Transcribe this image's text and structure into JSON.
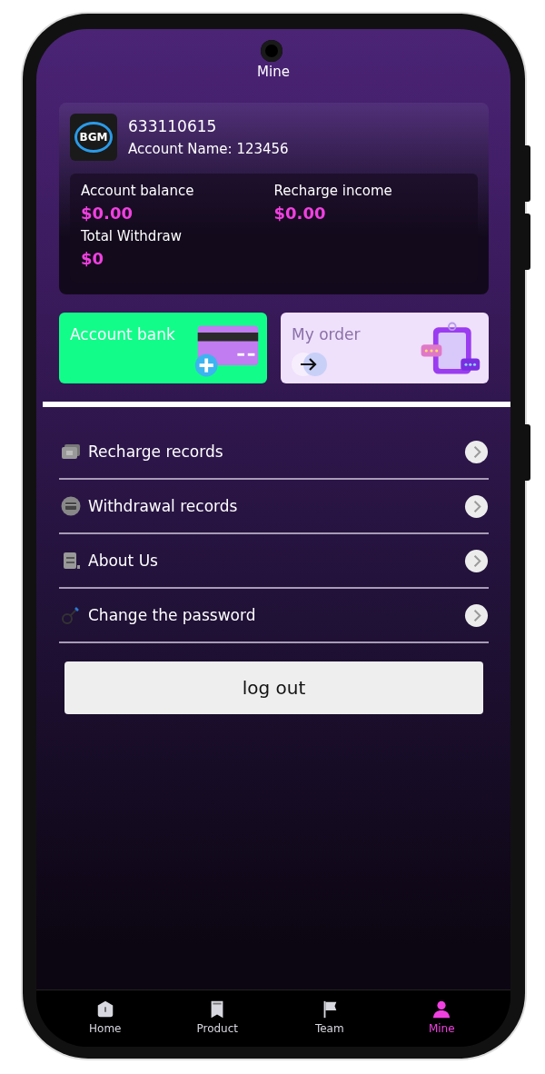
{
  "header": {
    "title": "Mine"
  },
  "account": {
    "logo_text": "BGM",
    "id": "633110615",
    "name": "Account Name: 123456",
    "stats": [
      {
        "label": "Account balance",
        "value": "$0.00"
      },
      {
        "label": "Recharge income",
        "value": "$0.00"
      },
      {
        "label": "Total Withdraw",
        "value": "$0"
      }
    ]
  },
  "tiles": [
    {
      "label": "Account bank",
      "kind": "bank"
    },
    {
      "label": "My order",
      "kind": "order"
    }
  ],
  "menu": [
    {
      "label": "Recharge records",
      "kind": "cash"
    },
    {
      "label": "Withdrawal records",
      "kind": "card"
    },
    {
      "label": "About Us",
      "kind": "doc"
    },
    {
      "label": "Change the password",
      "kind": "key"
    }
  ],
  "logout": "log out",
  "nav": [
    {
      "label": "Home",
      "kind": "home",
      "selected": false
    },
    {
      "label": "Product",
      "kind": "product",
      "selected": false
    },
    {
      "label": "Team",
      "kind": "team",
      "selected": false
    },
    {
      "label": "Mine",
      "kind": "mine",
      "selected": true
    }
  ]
}
